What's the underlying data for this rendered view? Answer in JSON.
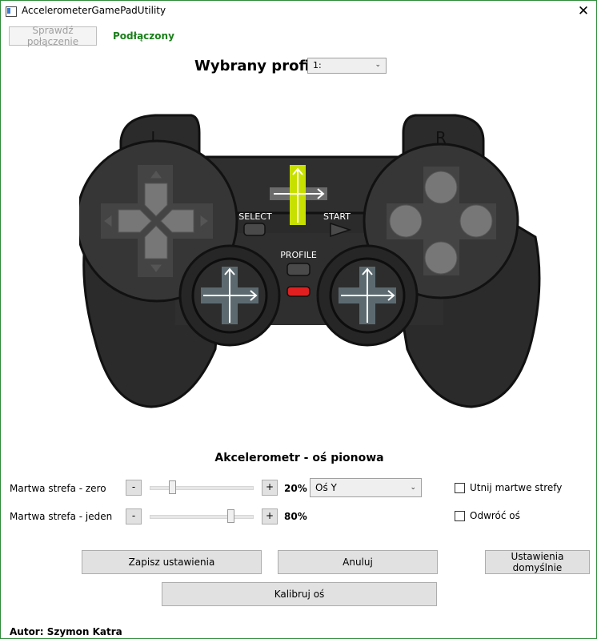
{
  "window": {
    "title": "AccelerometerGamePadUtility",
    "close_glyph": "✕"
  },
  "connection": {
    "check_button": "Sprawdź połączenie",
    "status": "Podłączony",
    "status_color": "#1a7f1a"
  },
  "profile": {
    "label": "Wybrany profil",
    "selected": "1:"
  },
  "gamepad": {
    "shoulder_left": "L",
    "shoulder_right": "R",
    "select_label": "SELECT",
    "start_label": "START",
    "profile_label": "PROFILE",
    "highlight_color": "#c8e000",
    "led_color": "#e02020"
  },
  "section": {
    "title": "Akcelerometr - oś pionowa"
  },
  "deadzone_zero": {
    "label": "Martwa strefa - zero",
    "minus": "-",
    "plus": "+",
    "value_text": "20%",
    "value": 0.2
  },
  "deadzone_one": {
    "label": "Martwa strefa - jeden",
    "minus": "-",
    "plus": "+",
    "value_text": "80%",
    "value": 0.8
  },
  "axis": {
    "selected": "Oś Y"
  },
  "options": {
    "trim_deadzones": "Utnij martwe strefy",
    "invert_axis": "Odwróć oś",
    "trim_checked": false,
    "invert_checked": false
  },
  "actions": {
    "save": "Zapisz ustawienia",
    "cancel": "Anuluj",
    "defaults": "Ustawienia domyślnie",
    "calibrate": "Kalibruj oś"
  },
  "footer": {
    "author": "Autor: Szymon Katra"
  }
}
